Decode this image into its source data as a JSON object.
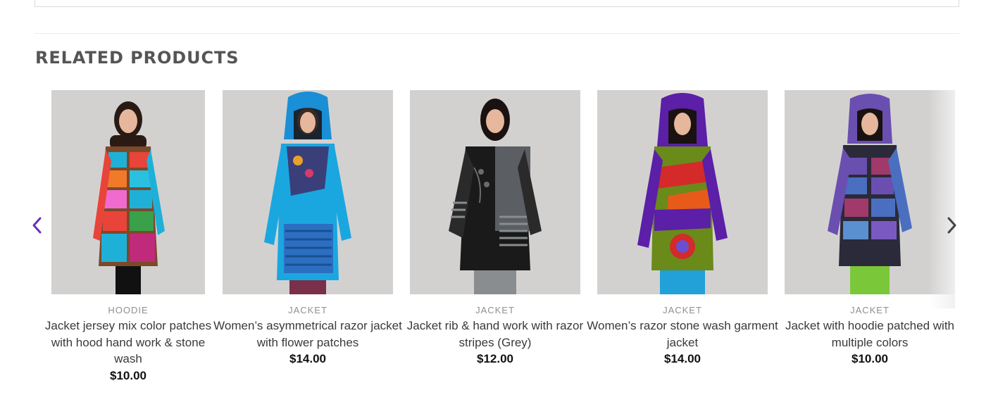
{
  "section": {
    "title": "RELATED PRODUCTS"
  },
  "nav": {
    "prev_icon": "chevron-left-icon",
    "next_icon": "chevron-right-icon",
    "accent": "#6b2fbf"
  },
  "products": [
    {
      "category": "HOODIE",
      "title": "Jacket jersey mix color patches with hood hand work & stone wash",
      "price": "$10.00",
      "image": "woman-patchwork-jacket-photo",
      "colors": [
        "#1fb0d8",
        "#e8443a",
        "#7a4a2a",
        "#f06ad0",
        "#2bc0e0"
      ]
    },
    {
      "category": "JACKET",
      "title": "Women’s asymmetrical razor jacket with flower patches",
      "price": "$14.00",
      "image": "woman-blue-hooded-jacket-photo",
      "colors": [
        "#1a8fd6",
        "#2c6fc2",
        "#3a3f7a",
        "#7a2f4a",
        "#1aa7e0"
      ]
    },
    {
      "category": "JACKET",
      "title": "Jacket rib & hand work with razor stripes (Grey)",
      "price": "$12.00",
      "image": "woman-black-grey-jacket-photo",
      "colors": [
        "#2a2a2a",
        "#5b5e62",
        "#1a1a1a",
        "#8a8d90",
        "#3b3b3b"
      ]
    },
    {
      "category": "JACKET",
      "title": "Women’s razor stone wash garment jacket",
      "price": "$14.00",
      "image": "woman-purple-hooded-jacket-photo",
      "colors": [
        "#5b1fa8",
        "#6a8a1a",
        "#e85a1a",
        "#d42a2a",
        "#22a0d8"
      ]
    },
    {
      "category": "JACKET",
      "title": "Jacket with hoodie patched with multiple colors",
      "price": "$10.00",
      "image": "woman-purple-patch-hoodie-photo",
      "colors": [
        "#6a4fb0",
        "#2a2a3a",
        "#4a6fc0",
        "#a03a6a",
        "#7ac83a"
      ]
    }
  ]
}
